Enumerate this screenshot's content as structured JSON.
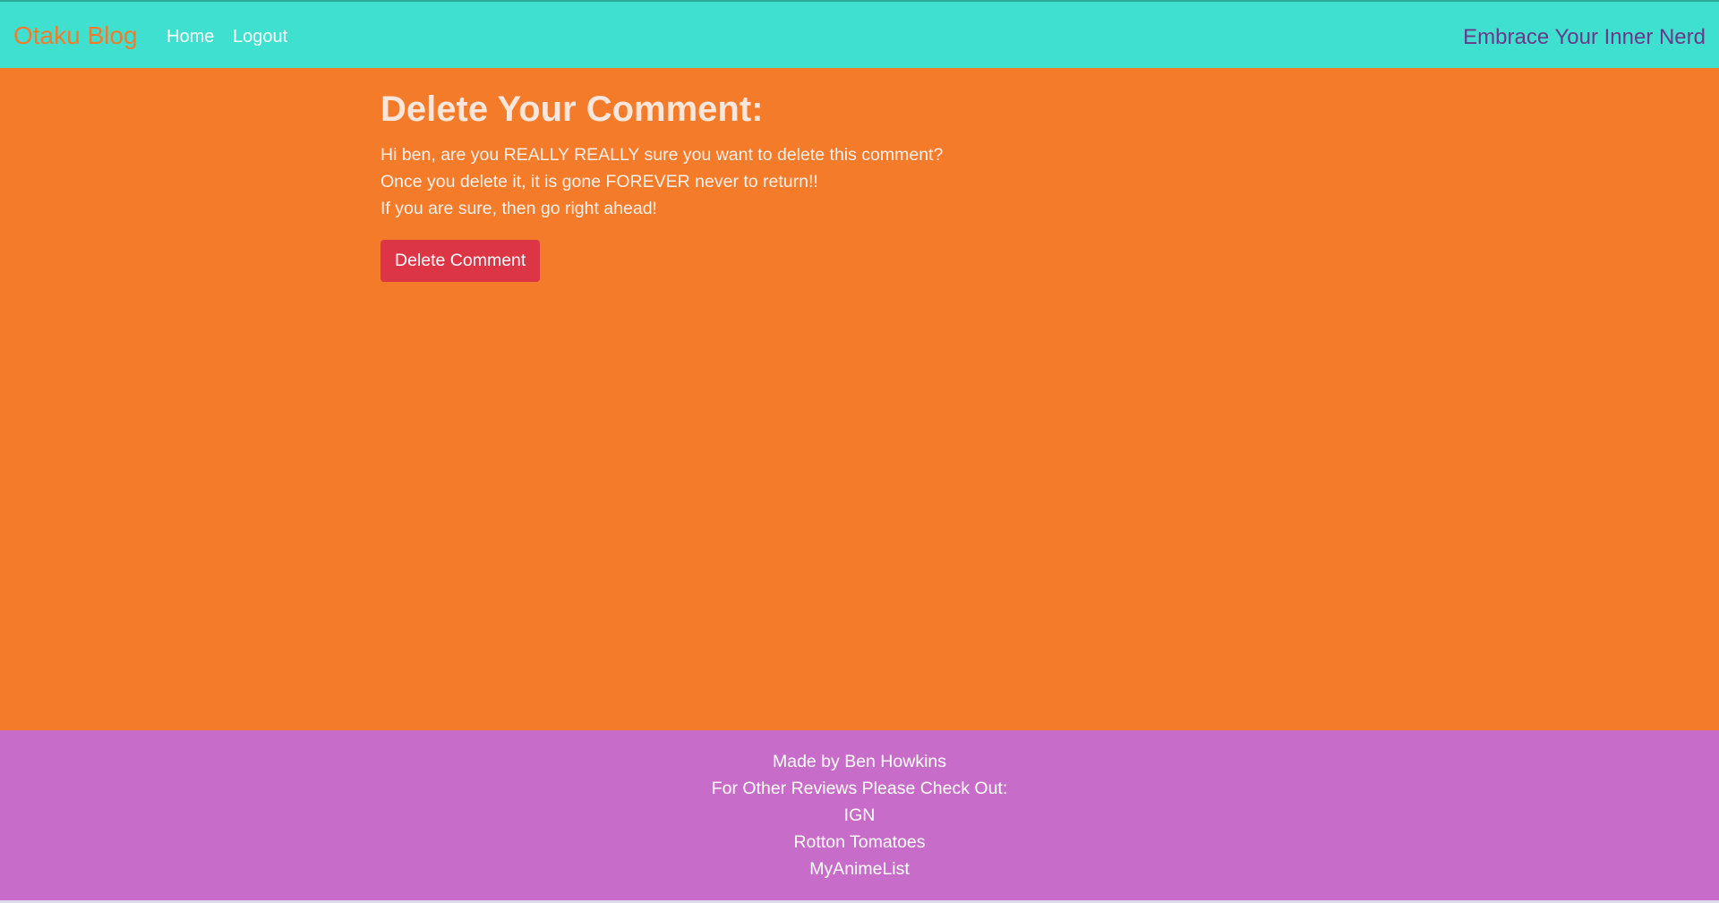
{
  "navbar": {
    "brand": "Otaku Blog",
    "links": [
      "Home",
      "Logout"
    ],
    "tagline": "Embrace Your Inner Nerd"
  },
  "main": {
    "heading": "Delete Your Comment:",
    "lines": [
      "Hi ben, are you REALLY REALLY sure you want to delete this comment?",
      "Once you delete it, it is gone FOREVER never to return!!",
      "If you are sure, then go right ahead!"
    ],
    "delete_button": "Delete Comment"
  },
  "footer": {
    "credit": "Made by Ben Howkins",
    "reviews_label": "For Other Reviews Please Check Out:",
    "links": [
      "IGN",
      "Rotton Tomatoes",
      "MyAnimeList"
    ]
  },
  "colors": {
    "navbar_bg": "#40e0d0",
    "brand": "#f47b2a",
    "tagline": "#6a3a8a",
    "main_bg": "#f47b2a",
    "danger": "#dc3545",
    "footer_bg": "#c76dc9"
  }
}
